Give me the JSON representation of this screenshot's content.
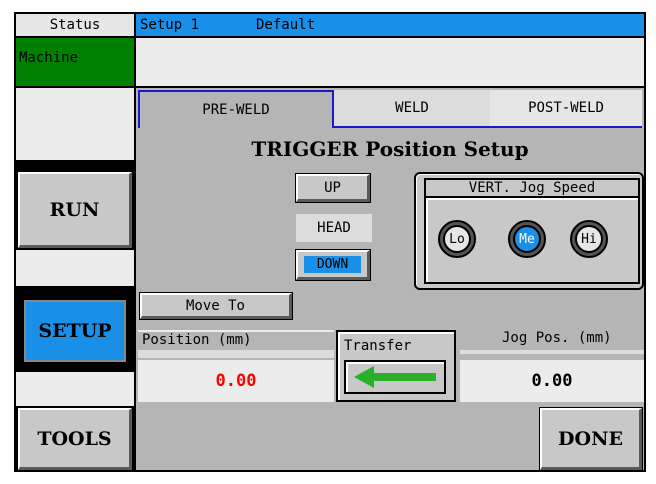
{
  "status": {
    "label": "Status",
    "value": "Machine",
    "value_color": "#008000"
  },
  "header": {
    "setup": "Setup 1",
    "name": "Default",
    "bar_color": "#1a8fe8"
  },
  "tabs": [
    {
      "label": "PRE-WELD",
      "active": true
    },
    {
      "label": "WELD",
      "active": false
    },
    {
      "label": "POST-WELD",
      "active": false
    }
  ],
  "page_title": "TRIGGER Position Setup",
  "nav": {
    "run": "RUN",
    "setup": "SETUP",
    "tools": "TOOLS",
    "done": "DONE",
    "setup_active_color": "#1a8fe8"
  },
  "head": {
    "up": "UP",
    "label": "HEAD",
    "down": "DOWN",
    "down_active": true
  },
  "jog_speed": {
    "title": "VERT. Jog Speed",
    "options": [
      {
        "label": "Lo",
        "selected": false
      },
      {
        "label": "Me",
        "selected": true
      },
      {
        "label": "Hi",
        "selected": false
      }
    ]
  },
  "move_to": {
    "label": "Move To"
  },
  "position": {
    "label": "Position (mm)",
    "value": "0.00",
    "value_color": "#ff0000"
  },
  "transfer": {
    "label": "Transfer",
    "arrow": "left-arrow-icon",
    "arrow_color": "#28b028"
  },
  "jog_pos": {
    "label": "Jog Pos. (mm)",
    "value": "0.00"
  }
}
